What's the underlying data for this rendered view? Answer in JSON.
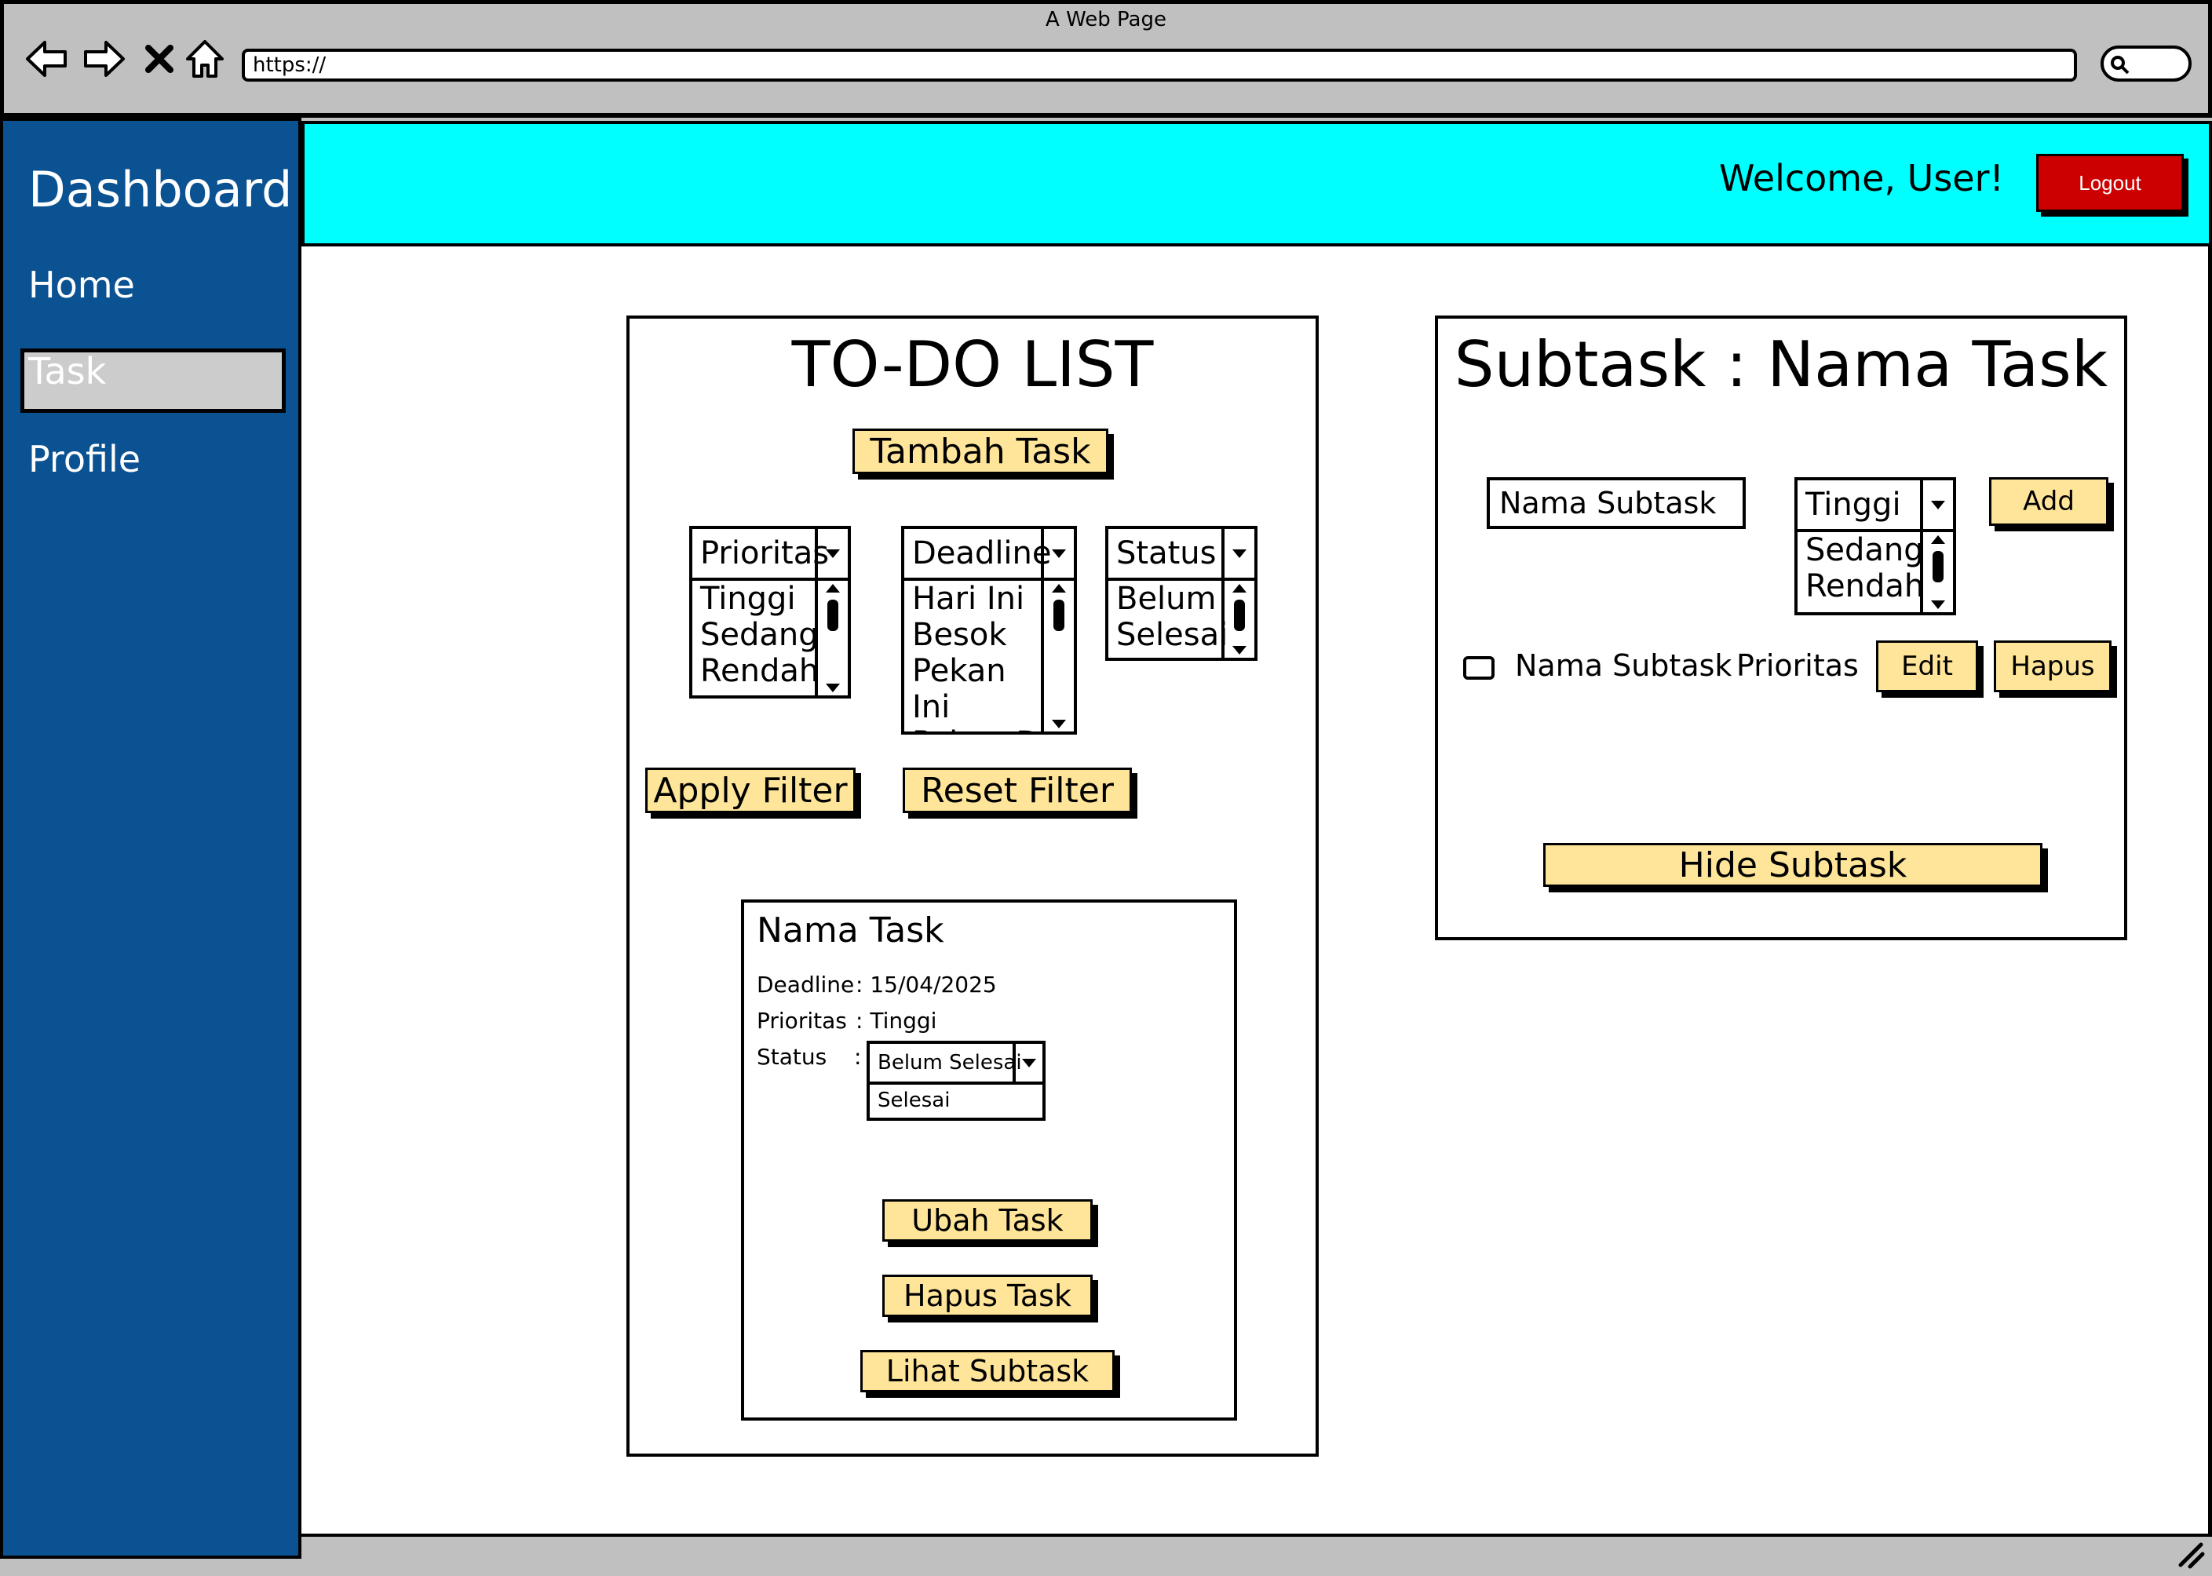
{
  "window": {
    "title": "A Web Page",
    "url": "https://"
  },
  "sidebar": {
    "title": "Dashboard",
    "items": [
      {
        "label": "Home"
      },
      {
        "label": "Task"
      },
      {
        "label": "Profile"
      }
    ]
  },
  "header": {
    "welcome": "Welcome, User!",
    "logout_label": "Logout",
    "logout_color": "#cc0000",
    "accent": "#00ffff"
  },
  "todo": {
    "title": "TO-DO LIST",
    "add_task_label": "Tambah Task",
    "filters": {
      "priority": {
        "selected": "Prioritas",
        "options": [
          "Tinggi",
          "Sedang",
          "Rendah"
        ]
      },
      "deadline": {
        "selected": "Deadline",
        "options": [
          "Hari Ini",
          "Besok",
          "Pekan Ini",
          "Pekan De"
        ]
      },
      "status": {
        "selected": "Status",
        "options": [
          "Belum",
          "Selesai"
        ]
      }
    },
    "apply_filter_label": "Apply Filter",
    "reset_filter_label": "Reset Filter",
    "card": {
      "name": "Nama Task",
      "deadline_label": "Deadline",
      "deadline_value": ": 15/04/2025",
      "priority_label": "Prioritas",
      "priority_value": ": Tinggi",
      "status_label": "Status",
      "status_colon": ":",
      "status_selected": "Belum Selesai",
      "status_options": [
        "Selesai"
      ],
      "edit_label": "Ubah Task",
      "delete_label": "Hapus Task",
      "view_subtask_label": "Lihat Subtask"
    }
  },
  "subtask": {
    "title": "Subtask : Nama Task",
    "name_input_value": "Nama Subtask",
    "priority": {
      "selected": "Tinggi",
      "options": [
        "Sedang",
        "Rendah"
      ]
    },
    "add_label": "Add",
    "item": {
      "name": "Nama Subtask",
      "priority": "Prioritas",
      "edit_label": "Edit",
      "delete_label": "Hapus"
    },
    "hide_label": "Hide Subtask"
  },
  "colors": {
    "sidebar": "#0a5292",
    "button": "#ffe599"
  }
}
